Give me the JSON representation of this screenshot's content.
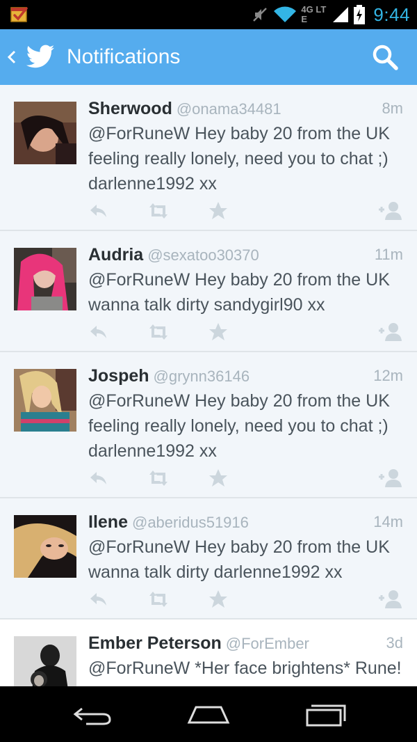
{
  "status_bar": {
    "time": "9:44",
    "network_label": "4G LTE",
    "icons": [
      "tasker-check-icon",
      "mute-icon",
      "wifi-icon",
      "signal-icon",
      "battery-charging-icon"
    ]
  },
  "action_bar": {
    "title": "Notifications",
    "icons": [
      "back-chevron-icon",
      "twitter-bird-icon",
      "search-icon"
    ],
    "color": "#55acee"
  },
  "tweets": [
    {
      "name": "Sherwood",
      "handle": "@onama34481",
      "age": "8m",
      "text": "@ForRuneW Hey baby 20 from the UK feeling really lonely, need you to chat ;) darlenne1992 xx"
    },
    {
      "name": "Audria",
      "handle": "@sexatoo30370",
      "age": "11m",
      "text": "@ForRuneW Hey baby 20 from the UK wanna talk dirty sandygirl90 xx"
    },
    {
      "name": "Jospeh",
      "handle": "@grynn36146",
      "age": "12m",
      "text": "@ForRuneW Hey baby 20 from the UK feeling really lonely, need you to chat ;) darlenne1992 xx"
    },
    {
      "name": "Ilene",
      "handle": "@aberidus51916",
      "age": "14m",
      "text": "@ForRuneW Hey baby 20 from the UK wanna talk dirty darlenne1992 xx"
    },
    {
      "name": "Ember Peterson",
      "handle": "@ForEmber",
      "age": "3d",
      "text": "@ForRuneW *Her face brightens* Rune! Hey! I'm tired, but I'm wonderful"
    }
  ],
  "tweet_action_icons": [
    "reply-icon",
    "retweet-icon",
    "favorite-star-icon",
    "follow-user-icon"
  ],
  "nav_bar": {
    "icons": [
      "nav-back-icon",
      "nav-home-icon",
      "nav-recent-apps-icon"
    ]
  }
}
